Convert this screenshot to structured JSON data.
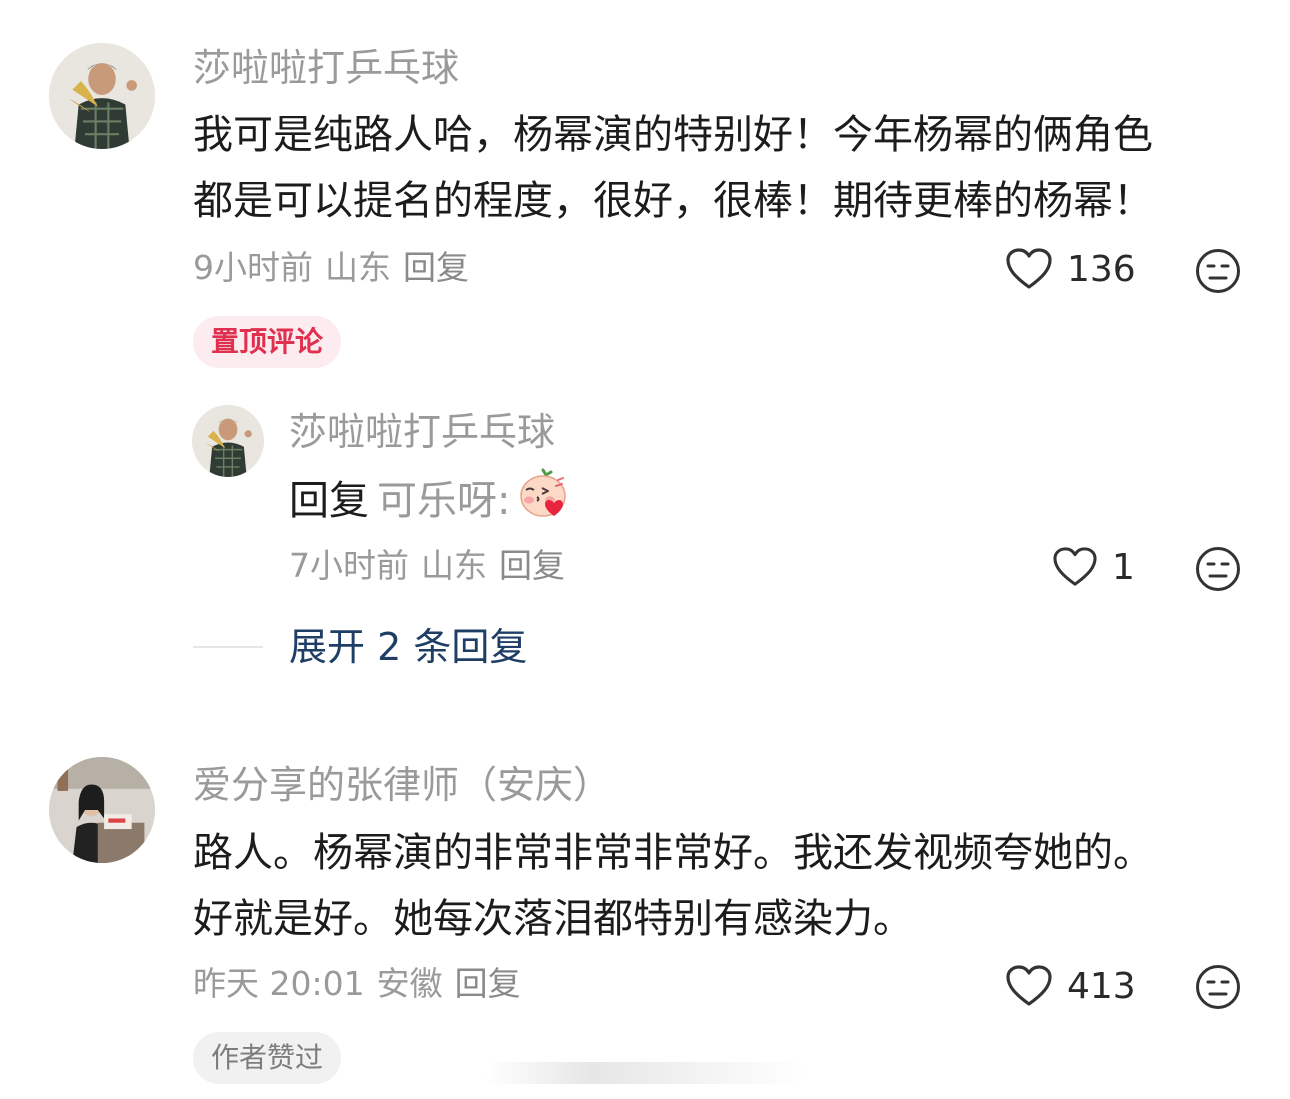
{
  "comments": [
    {
      "username": "莎啦啦打乒乓球",
      "content_lines": [
        "我可是纯路人哈，杨幂演的特别好！今年杨幂的俩角色",
        "都是可以提名的程度，很好，很棒！期待更棒的杨幂！"
      ],
      "time": "9小时前",
      "location": "山东",
      "reply_label": "回复",
      "likes": "136",
      "badge": "置顶评论",
      "replies": [
        {
          "username": "莎啦啦打乒乓球",
          "reply_prefix": "回复",
          "reply_target": "可乐呀:",
          "emoji": "blush-kiss-emoji",
          "time": "7小时前",
          "location": "山东",
          "reply_label": "回复",
          "likes": "1"
        }
      ],
      "expand_label": "展开 2 条回复"
    },
    {
      "username": "爱分享的张律师（安庆）",
      "content_lines": [
        "路人。杨幂演的非常非常非常好。我还发视频夸她的。",
        "好就是好。她每次落泪都特别有感染力。"
      ],
      "time": "昨天 20:01",
      "location": "安徽",
      "reply_label": "回复",
      "likes": "413",
      "badge": "作者赞过"
    }
  ],
  "colors": {
    "pinned_badge_bg": "#fdecef",
    "pinned_badge_text": "#e0304f",
    "expand_link": "#1f3e66",
    "meta_gray": "#9a9a9a"
  }
}
